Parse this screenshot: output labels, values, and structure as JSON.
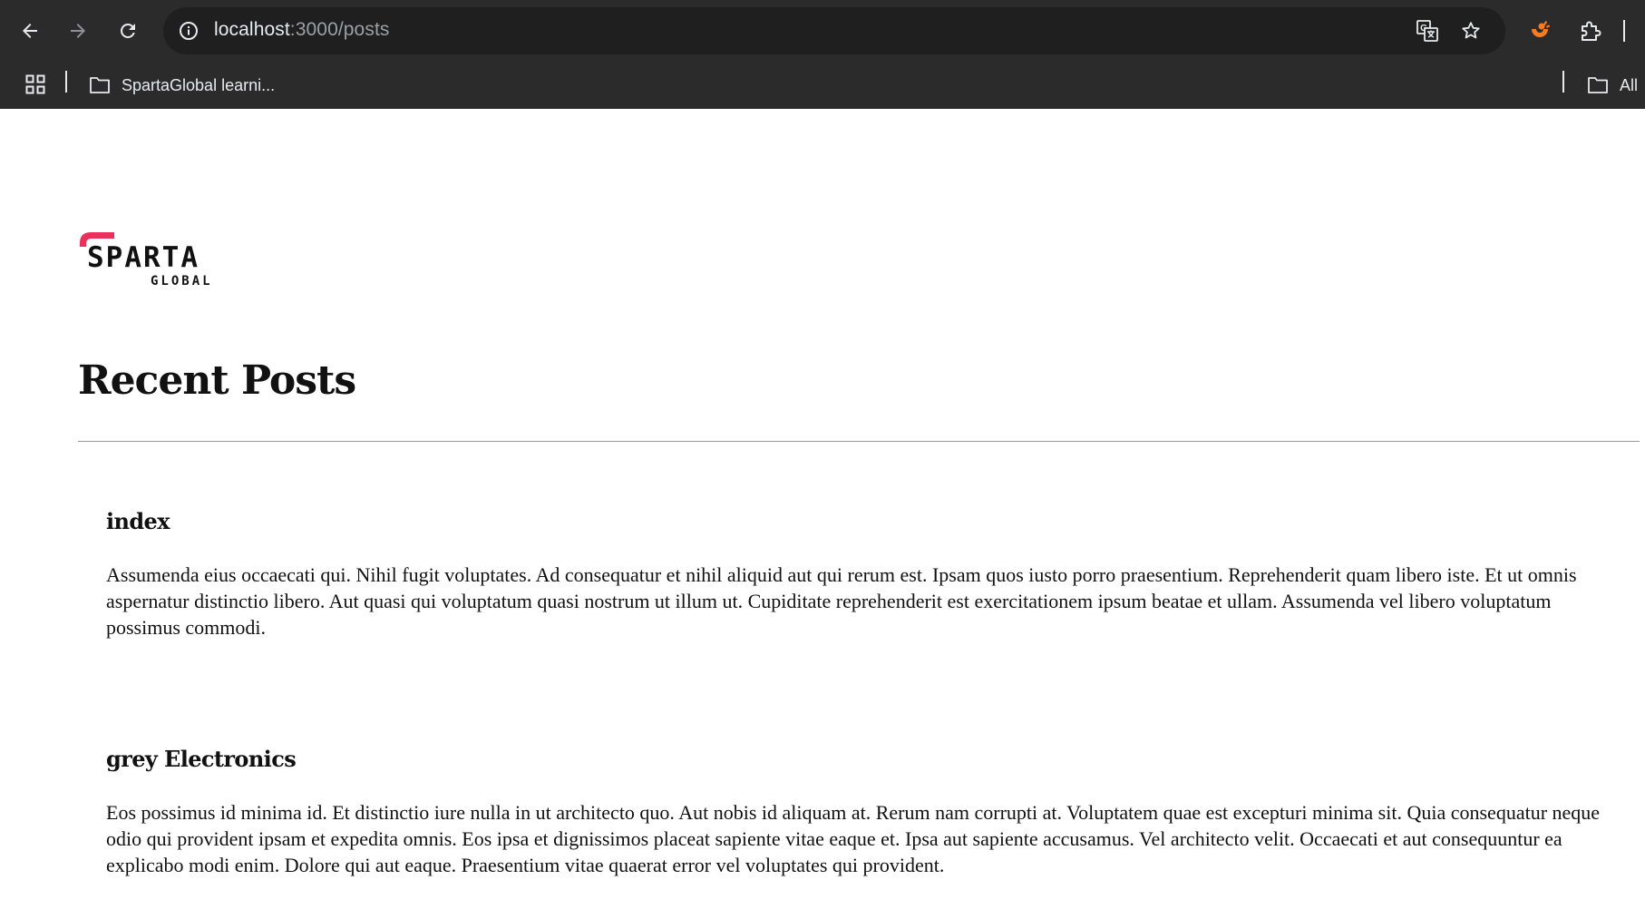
{
  "browser": {
    "url_host": "localhost",
    "url_path": ":3000/posts",
    "bookmarks": [
      {
        "label": "SpartaGlobal learni..."
      },
      {
        "label": "All"
      }
    ],
    "icons": {
      "back": "arrow-left-icon",
      "forward": "arrow-right-icon",
      "reload": "reload-icon",
      "site_info": "info-icon",
      "translate": "translate-icon",
      "bookmark_star": "star-icon",
      "extension_orange": "extension-icon",
      "extensions_menu": "puzzle-icon",
      "apps": "apps-grid-icon",
      "folder": "folder-icon"
    },
    "colors": {
      "chrome_bg": "#2b2b2b",
      "omnibox_bg": "#1f1f1f",
      "text": "#e8eaed",
      "muted": "#9aa0a6",
      "extension_accent": "#f57c1f"
    }
  },
  "page": {
    "logo": {
      "word": "SPARTA",
      "subword": "GLOBAL",
      "accent_color": "#e8315b"
    },
    "heading": "Recent Posts",
    "posts": [
      {
        "title": "index",
        "body": "Assumenda eius occaecati qui. Nihil fugit voluptates. Ad consequatur et nihil aliquid aut qui rerum est. Ipsam quos iusto porro praesentium. Reprehenderit quam libero iste. Et ut omnis aspernatur distinctio libero. Aut quasi qui voluptatum quasi nostrum ut illum ut. Cupiditate reprehenderit est exercitationem ipsum beatae et ullam. Assumenda vel libero voluptatum possimus commodi."
      },
      {
        "title": "grey Electronics",
        "body": "Eos possimus id minima id. Et distinctio iure nulla in ut architecto quo. Aut nobis id aliquam at. Rerum nam corrupti at. Voluptatem quae est excepturi minima sit. Quia consequatur neque odio qui provident ipsam et expedita omnis. Eos ipsa et dignissimos placeat sapiente vitae eaque et. Ipsa aut sapiente accusamus. Vel architecto velit. Occaecati et aut consequuntur ea explicabo modi enim. Dolore qui aut eaque. Praesentium vitae quaerat error vel voluptates qui provident."
      }
    ]
  }
}
